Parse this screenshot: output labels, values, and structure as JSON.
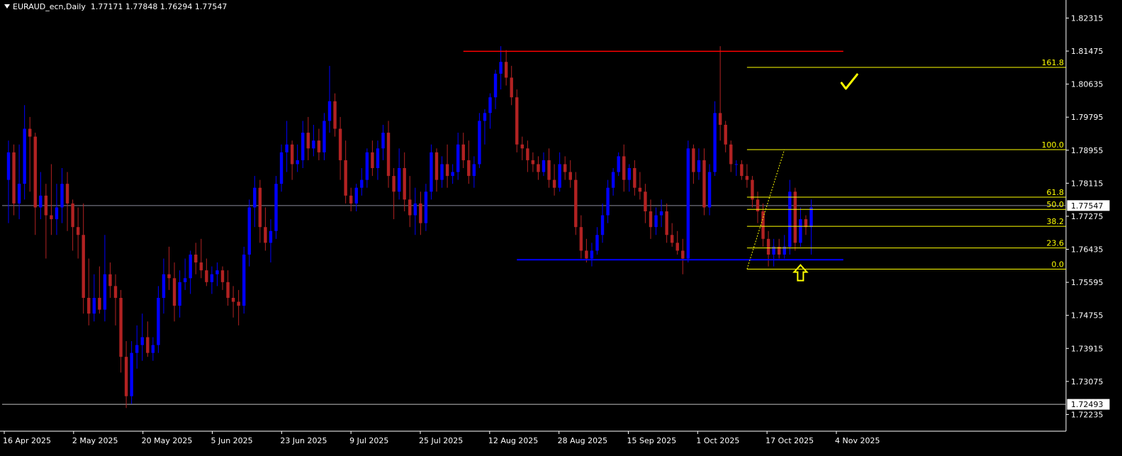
{
  "header": {
    "symbol": "EURAUD_ecn,Daily",
    "ohlc": "1.77171 1.77848 1.76294 1.77547"
  },
  "chart_data": {
    "type": "candlestick",
    "symbol": "EURAUD_ecn",
    "timeframe": "Daily",
    "ylim": [
      1.7181,
      1.8272
    ],
    "y_ticks": [
      "1.82315",
      "1.81475",
      "1.80635",
      "1.79795",
      "1.78955",
      "1.78115",
      "1.77275",
      "1.76435",
      "1.75595",
      "1.74755",
      "1.73915",
      "1.73075",
      "1.72235"
    ],
    "x_ticks": [
      "16 Apr 2025",
      "2 May 2025",
      "20 May 2025",
      "5 Jun 2025",
      "23 Jun 2025",
      "9 Jul 2025",
      "25 Jul 2025",
      "12 Aug 2025",
      "28 Aug 2025",
      "15 Sep 2025",
      "1 Oct 2025",
      "17 Oct 2025",
      "4 Nov 2025"
    ],
    "current_price": "1.77547",
    "marked_low": "1.72493",
    "colors": {
      "bull": "#0000ff",
      "bear": "#b22222",
      "background": "#000000",
      "axis": "#ffffff",
      "fib": "#ffff00",
      "resistance": "#ff0000",
      "support": "#0000ff"
    },
    "candles": [
      {
        "o": 1.782,
        "h": 1.792,
        "l": 1.771,
        "c": 1.789
      },
      {
        "o": 1.789,
        "h": 1.791,
        "l": 1.773,
        "c": 1.776
      },
      {
        "o": 1.776,
        "h": 1.791,
        "l": 1.772,
        "c": 1.781
      },
      {
        "o": 1.781,
        "h": 1.801,
        "l": 1.777,
        "c": 1.795
      },
      {
        "o": 1.795,
        "h": 1.798,
        "l": 1.779,
        "c": 1.793
      },
      {
        "o": 1.793,
        "h": 1.794,
        "l": 1.768,
        "c": 1.775
      },
      {
        "o": 1.775,
        "h": 1.784,
        "l": 1.772,
        "c": 1.778
      },
      {
        "o": 1.778,
        "h": 1.781,
        "l": 1.762,
        "c": 1.773
      },
      {
        "o": 1.773,
        "h": 1.786,
        "l": 1.768,
        "c": 1.772
      },
      {
        "o": 1.772,
        "h": 1.781,
        "l": 1.768,
        "c": 1.775
      },
      {
        "o": 1.775,
        "h": 1.785,
        "l": 1.771,
        "c": 1.781
      },
      {
        "o": 1.781,
        "h": 1.784,
        "l": 1.769,
        "c": 1.776
      },
      {
        "o": 1.776,
        "h": 1.777,
        "l": 1.764,
        "c": 1.77
      },
      {
        "o": 1.77,
        "h": 1.775,
        "l": 1.762,
        "c": 1.768
      },
      {
        "o": 1.768,
        "h": 1.776,
        "l": 1.748,
        "c": 1.752
      },
      {
        "o": 1.752,
        "h": 1.762,
        "l": 1.745,
        "c": 1.748
      },
      {
        "o": 1.748,
        "h": 1.758,
        "l": 1.746,
        "c": 1.752
      },
      {
        "o": 1.752,
        "h": 1.76,
        "l": 1.748,
        "c": 1.749
      },
      {
        "o": 1.749,
        "h": 1.768,
        "l": 1.746,
        "c": 1.758
      },
      {
        "o": 1.758,
        "h": 1.761,
        "l": 1.752,
        "c": 1.755
      },
      {
        "o": 1.755,
        "h": 1.758,
        "l": 1.745,
        "c": 1.752
      },
      {
        "o": 1.752,
        "h": 1.754,
        "l": 1.733,
        "c": 1.737
      },
      {
        "o": 1.737,
        "h": 1.741,
        "l": 1.724,
        "c": 1.727
      },
      {
        "o": 1.727,
        "h": 1.741,
        "l": 1.725,
        "c": 1.738
      },
      {
        "o": 1.738,
        "h": 1.745,
        "l": 1.734,
        "c": 1.74
      },
      {
        "o": 1.74,
        "h": 1.748,
        "l": 1.736,
        "c": 1.742
      },
      {
        "o": 1.742,
        "h": 1.746,
        "l": 1.737,
        "c": 1.738
      },
      {
        "o": 1.738,
        "h": 1.742,
        "l": 1.736,
        "c": 1.74
      },
      {
        "o": 1.74,
        "h": 1.755,
        "l": 1.738,
        "c": 1.752
      },
      {
        "o": 1.752,
        "h": 1.762,
        "l": 1.748,
        "c": 1.758
      },
      {
        "o": 1.758,
        "h": 1.765,
        "l": 1.754,
        "c": 1.757
      },
      {
        "o": 1.757,
        "h": 1.761,
        "l": 1.746,
        "c": 1.75
      },
      {
        "o": 1.75,
        "h": 1.759,
        "l": 1.747,
        "c": 1.756
      },
      {
        "o": 1.756,
        "h": 1.762,
        "l": 1.754,
        "c": 1.757
      },
      {
        "o": 1.757,
        "h": 1.764,
        "l": 1.753,
        "c": 1.763
      },
      {
        "o": 1.763,
        "h": 1.766,
        "l": 1.758,
        "c": 1.761
      },
      {
        "o": 1.761,
        "h": 1.767,
        "l": 1.757,
        "c": 1.759
      },
      {
        "o": 1.759,
        "h": 1.762,
        "l": 1.755,
        "c": 1.756
      },
      {
        "o": 1.756,
        "h": 1.76,
        "l": 1.753,
        "c": 1.758
      },
      {
        "o": 1.758,
        "h": 1.761,
        "l": 1.755,
        "c": 1.759
      },
      {
        "o": 1.759,
        "h": 1.76,
        "l": 1.754,
        "c": 1.756
      },
      {
        "o": 1.756,
        "h": 1.759,
        "l": 1.75,
        "c": 1.752
      },
      {
        "o": 1.752,
        "h": 1.755,
        "l": 1.747,
        "c": 1.751
      },
      {
        "o": 1.751,
        "h": 1.754,
        "l": 1.745,
        "c": 1.75
      },
      {
        "o": 1.75,
        "h": 1.765,
        "l": 1.748,
        "c": 1.763
      },
      {
        "o": 1.763,
        "h": 1.777,
        "l": 1.76,
        "c": 1.775
      },
      {
        "o": 1.775,
        "h": 1.783,
        "l": 1.77,
        "c": 1.78
      },
      {
        "o": 1.78,
        "h": 1.782,
        "l": 1.766,
        "c": 1.77
      },
      {
        "o": 1.77,
        "h": 1.775,
        "l": 1.764,
        "c": 1.766
      },
      {
        "o": 1.766,
        "h": 1.772,
        "l": 1.761,
        "c": 1.769
      },
      {
        "o": 1.769,
        "h": 1.783,
        "l": 1.767,
        "c": 1.781
      },
      {
        "o": 1.781,
        "h": 1.791,
        "l": 1.779,
        "c": 1.789
      },
      {
        "o": 1.789,
        "h": 1.797,
        "l": 1.784,
        "c": 1.791
      },
      {
        "o": 1.791,
        "h": 1.792,
        "l": 1.782,
        "c": 1.786
      },
      {
        "o": 1.786,
        "h": 1.791,
        "l": 1.784,
        "c": 1.787
      },
      {
        "o": 1.787,
        "h": 1.797,
        "l": 1.785,
        "c": 1.794
      },
      {
        "o": 1.794,
        "h": 1.798,
        "l": 1.787,
        "c": 1.79
      },
      {
        "o": 1.79,
        "h": 1.796,
        "l": 1.788,
        "c": 1.792
      },
      {
        "o": 1.792,
        "h": 1.795,
        "l": 1.787,
        "c": 1.789
      },
      {
        "o": 1.789,
        "h": 1.799,
        "l": 1.787,
        "c": 1.797
      },
      {
        "o": 1.797,
        "h": 1.811,
        "l": 1.794,
        "c": 1.802
      },
      {
        "o": 1.802,
        "h": 1.804,
        "l": 1.793,
        "c": 1.795
      },
      {
        "o": 1.795,
        "h": 1.798,
        "l": 1.782,
        "c": 1.787
      },
      {
        "o": 1.787,
        "h": 1.792,
        "l": 1.776,
        "c": 1.778
      },
      {
        "o": 1.778,
        "h": 1.78,
        "l": 1.774,
        "c": 1.776
      },
      {
        "o": 1.776,
        "h": 1.781,
        "l": 1.774,
        "c": 1.78
      },
      {
        "o": 1.78,
        "h": 1.785,
        "l": 1.778,
        "c": 1.782
      },
      {
        "o": 1.782,
        "h": 1.79,
        "l": 1.78,
        "c": 1.789
      },
      {
        "o": 1.789,
        "h": 1.792,
        "l": 1.783,
        "c": 1.785
      },
      {
        "o": 1.785,
        "h": 1.792,
        "l": 1.782,
        "c": 1.79
      },
      {
        "o": 1.79,
        "h": 1.796,
        "l": 1.787,
        "c": 1.794
      },
      {
        "o": 1.794,
        "h": 1.797,
        "l": 1.78,
        "c": 1.783
      },
      {
        "o": 1.783,
        "h": 1.785,
        "l": 1.772,
        "c": 1.779
      },
      {
        "o": 1.779,
        "h": 1.79,
        "l": 1.777,
        "c": 1.785
      },
      {
        "o": 1.785,
        "h": 1.789,
        "l": 1.774,
        "c": 1.777
      },
      {
        "o": 1.777,
        "h": 1.783,
        "l": 1.77,
        "c": 1.773
      },
      {
        "o": 1.773,
        "h": 1.78,
        "l": 1.768,
        "c": 1.776
      },
      {
        "o": 1.776,
        "h": 1.779,
        "l": 1.768,
        "c": 1.771
      },
      {
        "o": 1.771,
        "h": 1.781,
        "l": 1.769,
        "c": 1.779
      },
      {
        "o": 1.779,
        "h": 1.791,
        "l": 1.777,
        "c": 1.789
      },
      {
        "o": 1.789,
        "h": 1.79,
        "l": 1.779,
        "c": 1.782
      },
      {
        "o": 1.782,
        "h": 1.788,
        "l": 1.78,
        "c": 1.786
      },
      {
        "o": 1.786,
        "h": 1.791,
        "l": 1.78,
        "c": 1.783
      },
      {
        "o": 1.783,
        "h": 1.786,
        "l": 1.781,
        "c": 1.784
      },
      {
        "o": 1.784,
        "h": 1.794,
        "l": 1.782,
        "c": 1.791
      },
      {
        "o": 1.791,
        "h": 1.794,
        "l": 1.785,
        "c": 1.787
      },
      {
        "o": 1.787,
        "h": 1.792,
        "l": 1.781,
        "c": 1.783
      },
      {
        "o": 1.783,
        "h": 1.788,
        "l": 1.78,
        "c": 1.786
      },
      {
        "o": 1.786,
        "h": 1.799,
        "l": 1.785,
        "c": 1.797
      },
      {
        "o": 1.797,
        "h": 1.8,
        "l": 1.791,
        "c": 1.799
      },
      {
        "o": 1.799,
        "h": 1.804,
        "l": 1.795,
        "c": 1.803
      },
      {
        "o": 1.803,
        "h": 1.81,
        "l": 1.8,
        "c": 1.809
      },
      {
        "o": 1.809,
        "h": 1.816,
        "l": 1.805,
        "c": 1.812
      },
      {
        "o": 1.812,
        "h": 1.815,
        "l": 1.806,
        "c": 1.808
      },
      {
        "o": 1.808,
        "h": 1.811,
        "l": 1.801,
        "c": 1.803
      },
      {
        "o": 1.803,
        "h": 1.805,
        "l": 1.789,
        "c": 1.791
      },
      {
        "o": 1.791,
        "h": 1.793,
        "l": 1.787,
        "c": 1.79
      },
      {
        "o": 1.79,
        "h": 1.792,
        "l": 1.784,
        "c": 1.787
      },
      {
        "o": 1.787,
        "h": 1.789,
        "l": 1.784,
        "c": 1.786
      },
      {
        "o": 1.786,
        "h": 1.788,
        "l": 1.782,
        "c": 1.784
      },
      {
        "o": 1.784,
        "h": 1.789,
        "l": 1.783,
        "c": 1.787
      },
      {
        "o": 1.787,
        "h": 1.79,
        "l": 1.78,
        "c": 1.782
      },
      {
        "o": 1.782,
        "h": 1.786,
        "l": 1.778,
        "c": 1.78
      },
      {
        "o": 1.78,
        "h": 1.789,
        "l": 1.779,
        "c": 1.786
      },
      {
        "o": 1.786,
        "h": 1.788,
        "l": 1.782,
        "c": 1.784
      },
      {
        "o": 1.784,
        "h": 1.787,
        "l": 1.78,
        "c": 1.782
      },
      {
        "o": 1.782,
        "h": 1.784,
        "l": 1.768,
        "c": 1.77
      },
      {
        "o": 1.77,
        "h": 1.773,
        "l": 1.762,
        "c": 1.764
      },
      {
        "o": 1.764,
        "h": 1.767,
        "l": 1.761,
        "c": 1.762
      },
      {
        "o": 1.762,
        "h": 1.766,
        "l": 1.76,
        "c": 1.764
      },
      {
        "o": 1.764,
        "h": 1.77,
        "l": 1.763,
        "c": 1.768
      },
      {
        "o": 1.768,
        "h": 1.776,
        "l": 1.766,
        "c": 1.773
      },
      {
        "o": 1.773,
        "h": 1.782,
        "l": 1.771,
        "c": 1.78
      },
      {
        "o": 1.78,
        "h": 1.785,
        "l": 1.778,
        "c": 1.784
      },
      {
        "o": 1.784,
        "h": 1.789,
        "l": 1.783,
        "c": 1.788
      },
      {
        "o": 1.788,
        "h": 1.791,
        "l": 1.779,
        "c": 1.782
      },
      {
        "o": 1.782,
        "h": 1.786,
        "l": 1.779,
        "c": 1.785
      },
      {
        "o": 1.785,
        "h": 1.787,
        "l": 1.778,
        "c": 1.78
      },
      {
        "o": 1.78,
        "h": 1.784,
        "l": 1.777,
        "c": 1.779
      },
      {
        "o": 1.779,
        "h": 1.781,
        "l": 1.771,
        "c": 1.774
      },
      {
        "o": 1.774,
        "h": 1.777,
        "l": 1.767,
        "c": 1.77
      },
      {
        "o": 1.77,
        "h": 1.775,
        "l": 1.768,
        "c": 1.773
      },
      {
        "o": 1.773,
        "h": 1.777,
        "l": 1.77,
        "c": 1.774
      },
      {
        "o": 1.774,
        "h": 1.776,
        "l": 1.766,
        "c": 1.768
      },
      {
        "o": 1.768,
        "h": 1.771,
        "l": 1.765,
        "c": 1.766
      },
      {
        "o": 1.766,
        "h": 1.769,
        "l": 1.763,
        "c": 1.764
      },
      {
        "o": 1.764,
        "h": 1.767,
        "l": 1.758,
        "c": 1.762
      },
      {
        "o": 1.762,
        "h": 1.792,
        "l": 1.761,
        "c": 1.79
      },
      {
        "o": 1.79,
        "h": 1.791,
        "l": 1.781,
        "c": 1.784
      },
      {
        "o": 1.784,
        "h": 1.79,
        "l": 1.782,
        "c": 1.787
      },
      {
        "o": 1.787,
        "h": 1.79,
        "l": 1.773,
        "c": 1.775
      },
      {
        "o": 1.775,
        "h": 1.786,
        "l": 1.773,
        "c": 1.784
      },
      {
        "o": 1.784,
        "h": 1.802,
        "l": 1.783,
        "c": 1.799
      },
      {
        "o": 1.799,
        "h": 1.816,
        "l": 1.792,
        "c": 1.796
      },
      {
        "o": 1.796,
        "h": 1.797,
        "l": 1.789,
        "c": 1.791
      },
      {
        "o": 1.791,
        "h": 1.792,
        "l": 1.784,
        "c": 1.786
      },
      {
        "o": 1.786,
        "h": 1.787,
        "l": 1.783,
        "c": 1.786
      },
      {
        "o": 1.786,
        "h": 1.787,
        "l": 1.782,
        "c": 1.783
      },
      {
        "o": 1.783,
        "h": 1.786,
        "l": 1.78,
        "c": 1.782
      },
      {
        "o": 1.782,
        "h": 1.783,
        "l": 1.775,
        "c": 1.777
      },
      {
        "o": 1.777,
        "h": 1.779,
        "l": 1.771,
        "c": 1.774
      },
      {
        "o": 1.774,
        "h": 1.776,
        "l": 1.765,
        "c": 1.767
      },
      {
        "o": 1.767,
        "h": 1.769,
        "l": 1.76,
        "c": 1.763
      },
      {
        "o": 1.763,
        "h": 1.767,
        "l": 1.76,
        "c": 1.765
      },
      {
        "o": 1.765,
        "h": 1.767,
        "l": 1.762,
        "c": 1.763
      },
      {
        "o": 1.763,
        "h": 1.768,
        "l": 1.762,
        "c": 1.765
      },
      {
        "o": 1.765,
        "h": 1.782,
        "l": 1.763,
        "c": 1.779
      },
      {
        "o": 1.779,
        "h": 1.78,
        "l": 1.764,
        "c": 1.766
      },
      {
        "o": 1.766,
        "h": 1.775,
        "l": 1.765,
        "c": 1.772
      },
      {
        "o": 1.772,
        "h": 1.773,
        "l": 1.768,
        "c": 1.77
      },
      {
        "o": 1.77,
        "h": 1.777,
        "l": 1.763,
        "c": 1.775
      }
    ],
    "resistance_line": {
      "price": 1.8147,
      "from": 85,
      "to": 156
    },
    "support_line": {
      "price": 1.7617,
      "from": 95,
      "to": 156
    },
    "fibonacci": {
      "from": 138,
      "to": 156,
      "low": 1.7593,
      "high": 1.7897,
      "anchor_low_index": 138,
      "anchor_high_index": 145,
      "levels": [
        {
          "label": "161.8",
          "price": 1.8106
        },
        {
          "label": "100.0",
          "price": 1.7897
        },
        {
          "label": "61.8",
          "price": 1.7776
        },
        {
          "label": "50.0",
          "price": 1.7745
        },
        {
          "label": "38.2",
          "price": 1.7702
        },
        {
          "label": "23.6",
          "price": 1.7647
        },
        {
          "label": "0.0",
          "price": 1.7593
        }
      ]
    },
    "annotations": [
      {
        "kind": "checkmark",
        "price": 1.807,
        "index": 157
      },
      {
        "kind": "up-arrow",
        "price": 1.76,
        "index": 148
      }
    ]
  }
}
